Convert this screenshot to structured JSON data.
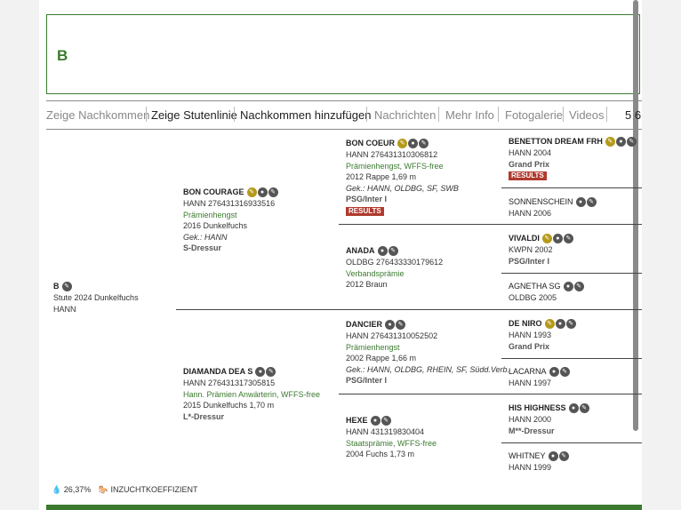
{
  "horse": {
    "name": "B",
    "line1": "Stute 2024 Dunkelfuchs",
    "line2": "HANN"
  },
  "tabs": [
    {
      "label": "Zeige Nachkommen",
      "dark": false
    },
    {
      "label": "Zeige Stutenlinie",
      "dark": true
    },
    {
      "label": "Nachkommen hinzufügen",
      "dark": true
    },
    {
      "label": "Nachrichten",
      "dark": false
    },
    {
      "label": "Mehr Info",
      "dark": false
    },
    {
      "label": "Fotogalerie",
      "dark": false
    },
    {
      "label": "Videos",
      "dark": false
    }
  ],
  "tab_numbers": "5 6",
  "gen1": {
    "sire": {
      "name": "BON COURAGE",
      "line1": "HANN 276431316933516",
      "line2": "Prämienhengst",
      "line3": "2016 Dunkelfuchs",
      "line4": "Gek.: HANN",
      "line5": "S-Dressur"
    },
    "dam": {
      "name": "DIAMANDA DEA S",
      "line1": "HANN 276431317305815",
      "line2": "Hann. Prämien Anwärterin, WFFS-free",
      "line3": "2015 Dunkelfuchs 1,70 m",
      "line4": "L*-Dressur"
    }
  },
  "gen2": {
    "ss": {
      "name": "BON COEUR",
      "line1": "HANN 276431310306812",
      "line2": "Prämienhengst, WFFS-free",
      "line3": "2012 Rappe 1,69 m",
      "line4": "Gek.: HANN, OLDBG, SF, SWB",
      "line5": "PSG/Inter I",
      "badge": "RESULTS"
    },
    "sd": {
      "name": "ANADA",
      "line1": "OLDBG 276433330179612",
      "line2": "Verbandsprämie",
      "line3": "2012 Braun"
    },
    "ds": {
      "name": "DANCIER",
      "line1": "HANN 276431310052502",
      "line2": "Prämienhengst",
      "line3": "2002 Rappe 1,66 m",
      "line4": "Gek.: HANN, OLDBG, RHEIN, SF, Südd.Verb.",
      "line5": "PSG/Inter I"
    },
    "dd": {
      "name": "HEXE",
      "line1": "HANN 431319830404",
      "line2": "Staatsprämie, WFFS-free",
      "line3": "2004 Fuchs 1,73 m"
    }
  },
  "gen3": [
    {
      "name": "BENETTON DREAM FRH",
      "line1": "HANN 2004",
      "line2": "Grand Prix",
      "badge": "RESULTS"
    },
    {
      "name": "SONNENSCHEIN",
      "line1": "HANN 2006"
    },
    {
      "name": "VIVALDI",
      "line1": "KWPN 2002",
      "line2": "PSG/Inter I"
    },
    {
      "name": "AGNETHA SG",
      "line1": "OLDBG 2005"
    },
    {
      "name": "DE NIRO",
      "line1": "HANN 1993",
      "line2": "Grand Prix"
    },
    {
      "name": "LACARNA",
      "line1": "HANN 1997"
    },
    {
      "name": "HIS HIGHNESS",
      "line1": "HANN 2000",
      "line2": "M**-Dressur"
    },
    {
      "name": "WHITNEY",
      "line1": "HANN 1999"
    }
  ],
  "footer": {
    "inbreeding": "26,37%",
    "label": "INZUCHTKOEFFIZIENT"
  },
  "colors": {
    "accent": "#3b7a2e",
    "results": "#b03a2e",
    "gold": "#b59a1a"
  }
}
